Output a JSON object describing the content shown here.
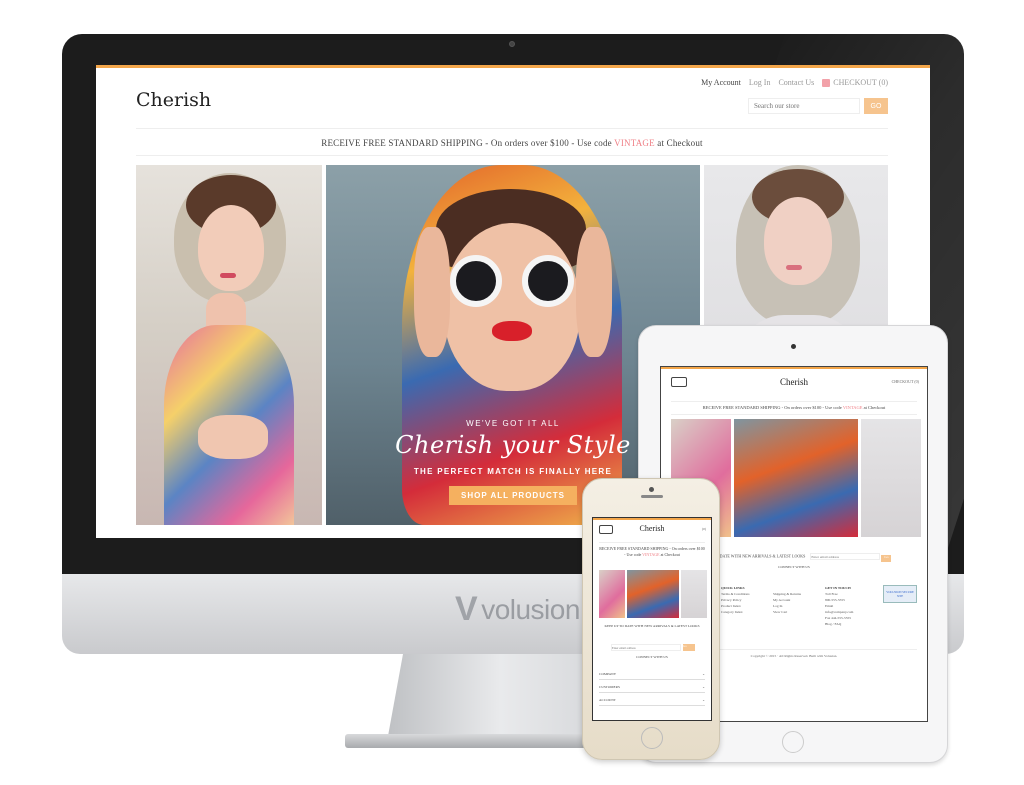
{
  "desktop": {
    "brand": "Cherish",
    "links": [
      "My Account",
      "Log In",
      "Contact Us"
    ],
    "cart_label": "CHECKOUT (0)",
    "search": {
      "placeholder": "Search our store",
      "button": "GO"
    },
    "promo": {
      "prefix": "RECEIVE FREE STANDARD SHIPPING - On orders over $100 - Use code ",
      "code": "VINTAGE",
      "suffix": " at Checkout"
    },
    "hero": {
      "pre_title": "WE'VE GOT IT ALL",
      "title": "Cherish your Style",
      "subtitle": "THE PERFECT MATCH IS FINALLY HERE",
      "cta": "SHOP ALL PRODUCTS"
    }
  },
  "monitor_logo": "volusion",
  "tablet": {
    "brand": "Cherish",
    "cart_label": "CHECKOUT (0)",
    "promo_prefix": "RECEIVE FREE STANDARD SHIPPING - On orders over $100 - Use code ",
    "promo_code": "VINTAGE",
    "promo_suffix": " at Checkout",
    "newsletter": "KEEP UP TO DATE WITH NEW ARRIVALS & LATEST LOOKS",
    "newsletter_placeholder": "Enter email address",
    "newsletter_button": "Go",
    "connect": "CONNECT WITH US",
    "footer_cols": [
      {
        "heading": "QUICK LINKS",
        "items": [
          "Terms & Conditions",
          "Privacy Policy",
          "Product Index",
          "Category Index"
        ]
      },
      {
        "heading": "",
        "items": [
          "Shipping & Returns",
          "My Account",
          "Log In",
          "View Cart"
        ]
      },
      {
        "heading": "GET IN TOUCH",
        "items": [
          "Toll Free",
          "800-555-5555",
          "Email",
          "info@company.com",
          "Fax 444-555-5555",
          "Blog / FAQ"
        ]
      }
    ],
    "copyright": "Copyright © 2015 · All Rights Reserved. Built with Volusion.",
    "badge": "VOLUSION SECURE SITE"
  },
  "phone": {
    "brand": "Cherish",
    "cart_label": "(0)",
    "promo_prefix": "RECEIVE FREE STANDARD SHIPPING - On orders over $100 - Use code ",
    "promo_code": "VINTAGE",
    "promo_suffix": " at Checkout",
    "newsletter": "KEEP UP TO DATE WITH NEW ARRIVALS & LATEST LOOKS",
    "newsletter_placeholder": "Enter email address",
    "newsletter_button": "Go",
    "connect": "CONNECT WITH US",
    "accordion": [
      "COMPANY",
      "CUSTOMERS",
      "ACCOUNT"
    ]
  },
  "colors": {
    "accent": "#f3a64a",
    "promo_code": "#ef7f86",
    "cta": "#f5b05f"
  }
}
